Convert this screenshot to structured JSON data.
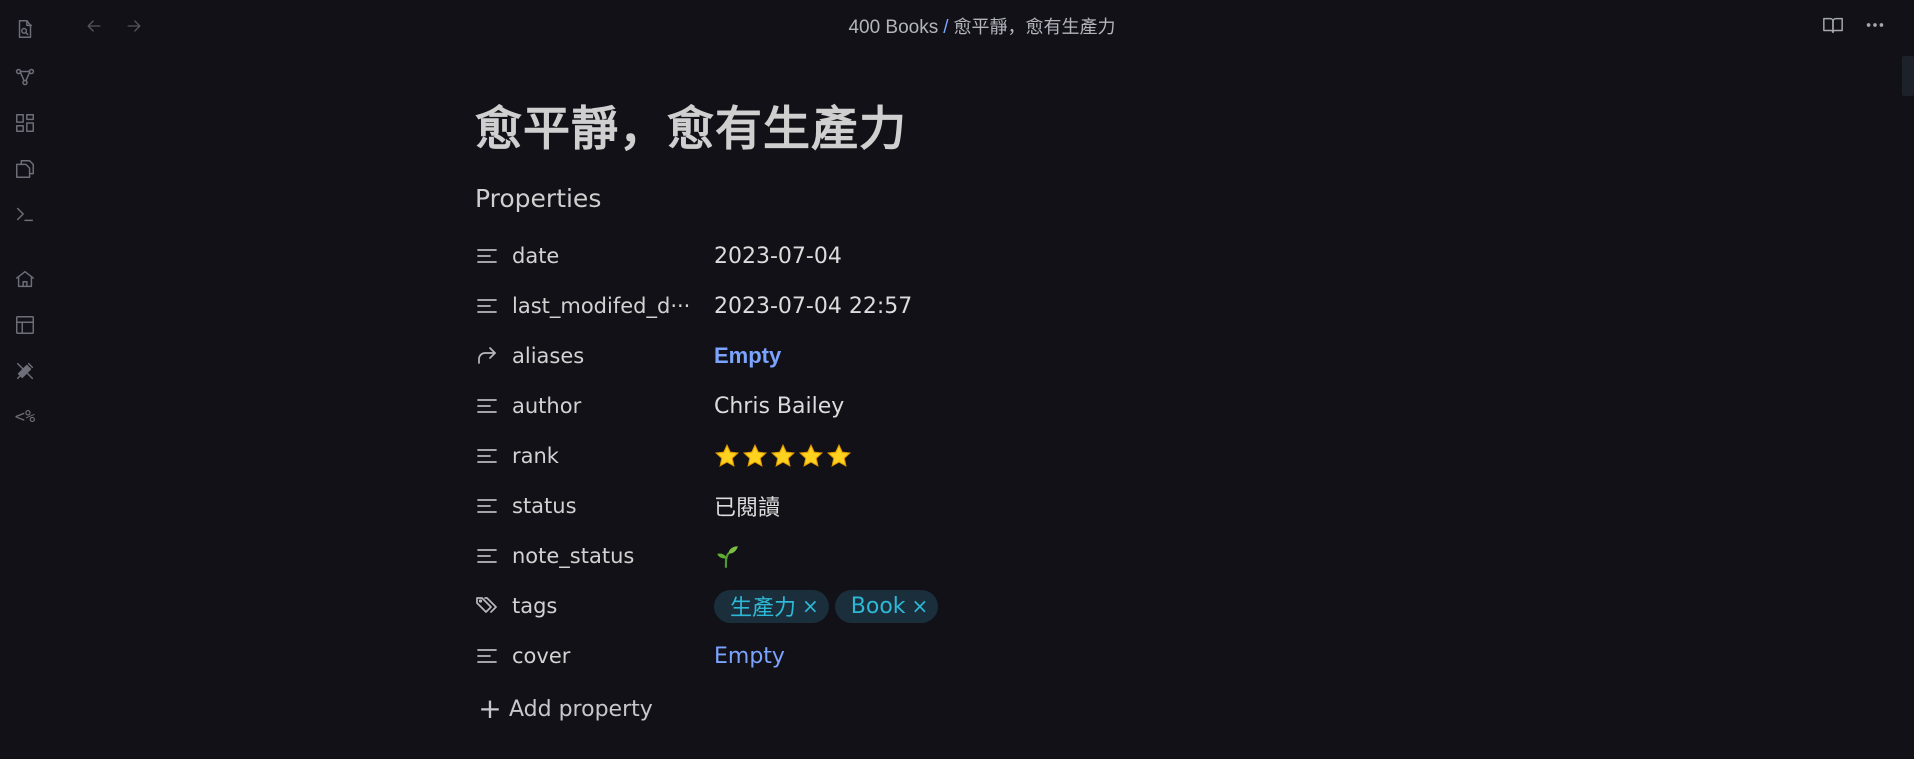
{
  "breadcrumb": {
    "folder": "400 Books",
    "separator": "/",
    "file": "愈平靜，愈有生產力"
  },
  "note": {
    "title": "愈平靜，愈有生產力"
  },
  "properties": {
    "heading": "Properties",
    "date": {
      "key": "date",
      "icon": "text-lines-icon",
      "value": "2023-07-04"
    },
    "last_modified": {
      "key": "last_modifed_d···",
      "icon": "text-lines-icon",
      "value": "2023-07-04 22:57"
    },
    "aliases": {
      "key": "aliases",
      "icon": "forward-arrow-icon",
      "value": "Empty"
    },
    "author": {
      "key": "author",
      "icon": "text-lines-icon",
      "value": "Chris Bailey"
    },
    "rank": {
      "key": "rank",
      "icon": "text-lines-icon",
      "rating": 5,
      "max": 5
    },
    "status": {
      "key": "status",
      "icon": "text-lines-icon",
      "value": "已閱讀"
    },
    "note_status": {
      "key": "note_status",
      "icon": "text-lines-icon",
      "emoji": "seedling-icon"
    },
    "tags": {
      "key": "tags",
      "icon": "tags-icon",
      "items": [
        {
          "label": "生產力",
          "remove": "×"
        },
        {
          "label": "Book",
          "remove": "×"
        }
      ]
    },
    "cover": {
      "key": "cover",
      "icon": "text-lines-icon",
      "value": "Empty"
    },
    "add_label": "Add property"
  },
  "ribbon": {
    "templater_label": "<%",
    "icons": [
      "file-search-icon",
      "graph-icon",
      "canvas-grid-icon",
      "copy-files-icon",
      "terminal-icon",
      "home-icon",
      "layout-icon",
      "tools-icon",
      "templater-icon"
    ]
  },
  "colors": {
    "background": "#111117",
    "accent": "#7ba4ff",
    "tag_bg": "#1a2e3c",
    "tag_text": "#2db8d6",
    "star": "#ffd21f"
  }
}
